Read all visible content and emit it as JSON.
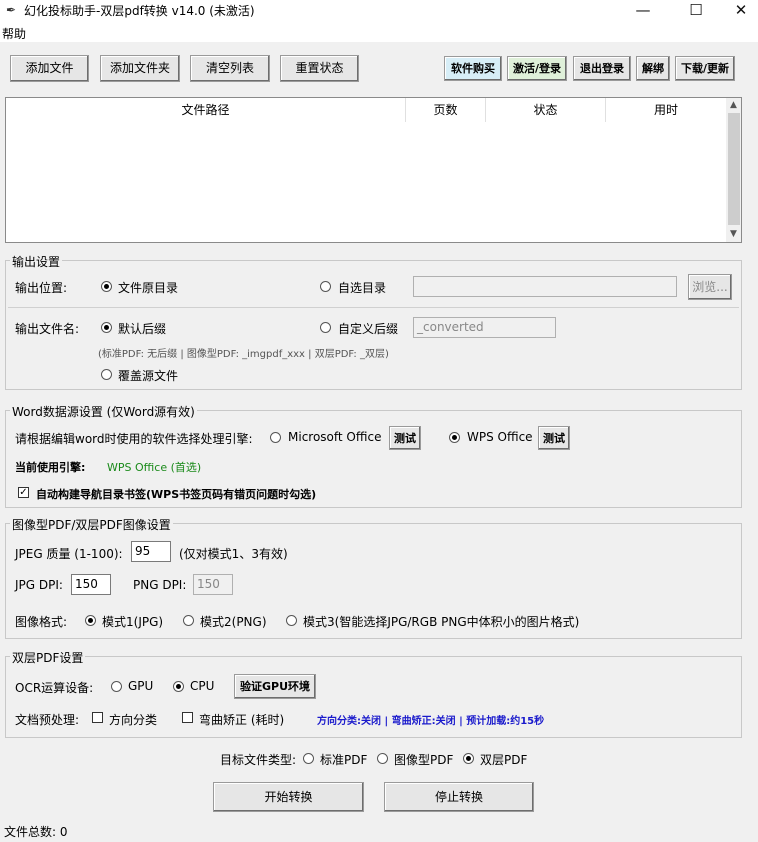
{
  "window": {
    "title": "幻化投标助手-双层pdf转换 v14.0 (未激活)",
    "icon": "feather-icon",
    "minimize": "—",
    "maximize": "☐",
    "close": "✕"
  },
  "menu": {
    "help": "帮助"
  },
  "toolbar": {
    "add_file": "添加文件",
    "add_folder": "添加文件夹",
    "clear_list": "清空列表",
    "reset_status": "重置状态",
    "buy": "软件购买",
    "activate": "激活/登录",
    "logout": "退出登录",
    "unbind": "解绑",
    "download": "下载/更新"
  },
  "file_list": {
    "columns": [
      "文件路径",
      "页数",
      "状态",
      "用时"
    ],
    "rows": []
  },
  "output": {
    "group_title": "输出设置",
    "location_label": "输出位置:",
    "loc_source": "文件原目录",
    "loc_custom": "自选目录",
    "custom_dir_value": "",
    "browse": "浏览...",
    "filename_label": "输出文件名:",
    "name_default": "默认后缀",
    "name_custom": "自定义后缀",
    "suffix_value": "_converted",
    "hint": "(标准PDF: 无后缀 | 图像型PDF: _imgpdf_xxx | 双层PDF: _双层)",
    "overwrite": "覆盖源文件"
  },
  "word": {
    "group_title": "Word数据源设置 (仅Word源有效)",
    "prompt": "请根据编辑word时使用的软件选择处理引擎:",
    "ms_office": "Microsoft Office",
    "wps_office": "WPS Office",
    "test": "测试",
    "current_label": "当前使用引擎:",
    "current_value": "WPS Office (首选)",
    "current_color": "#1a8a1a",
    "auto_bookmark": "自动构建导航目录书签(WPS书签页码有错页问题时勾选)"
  },
  "image": {
    "group_title": "图像型PDF/双层PDF图像设置",
    "jpeg_quality_label": "JPEG 质量 (1-100):",
    "jpeg_quality": "95",
    "jpeg_note": "(仅对模式1、3有效)",
    "jpg_dpi_label": "JPG DPI:",
    "jpg_dpi": "150",
    "png_dpi_label": "PNG DPI:",
    "png_dpi": "150",
    "format_label": "图像格式:",
    "mode1": "模式1(JPG)",
    "mode2": "模式2(PNG)",
    "mode3": "模式3(智能选择JPG/RGB PNG中体积小的图片格式)"
  },
  "dual": {
    "group_title": "双层PDF设置",
    "ocr_label": "OCR运算设备:",
    "gpu": "GPU",
    "cpu": "CPU",
    "verify_gpu": "验证GPU环境",
    "preprocess_label": "文档预处理:",
    "orientation": "方向分类",
    "dewarp": "弯曲矫正 (耗时)",
    "status_text": "方向分类:关闭 | 弯曲矫正:关闭 | 预计加载:约15秒",
    "status_color": "#1a1acc"
  },
  "target": {
    "label": "目标文件类型:",
    "standard": "标准PDF",
    "image": "图像型PDF",
    "dual": "双层PDF"
  },
  "actions": {
    "start": "开始转换",
    "stop": "停止转换"
  },
  "status": {
    "file_count": "文件总数: 0"
  }
}
